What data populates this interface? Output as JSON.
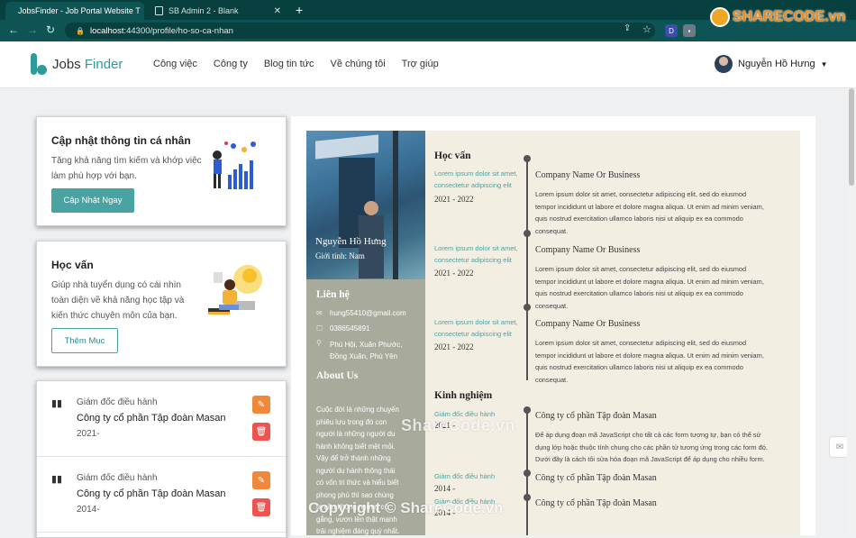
{
  "browser": {
    "tabs": [
      {
        "title": "JobsFinder - Job Portal Website T",
        "close": "✕"
      },
      {
        "title": "SB Admin 2 - Blank",
        "close": "✕"
      }
    ],
    "new_tab": "+",
    "url_host": "localhost",
    "url_rest": ":44300/profile/ho-so-ca-nhan"
  },
  "watermark": {
    "logo_text": "SHARECODE.vn",
    "center": "ShareCode.vn",
    "bottom": "Copyright © ShareCode.vn"
  },
  "nav": {
    "logo_main": "Jobs ",
    "logo_accent": "Finder",
    "menu": [
      "Công việc",
      "Công ty",
      "Blog tin tức",
      "Về chúng tôi",
      "Trợ giúp"
    ],
    "user_name": "Nguyễn Hồ Hưng"
  },
  "cards": {
    "update": {
      "title": "Cập nhật thông tin cá nhân",
      "desc_line1": "Tăng khả năng tìm kiếm và khớp việc",
      "desc_line2": "làm phù hợp với bạn.",
      "button": "Cập Nhật Ngay"
    },
    "education": {
      "title": "Học vấn",
      "desc_line1": "Giúp nhà tuyển dụng có cái nhìn",
      "desc_line2": "toàn diện về khả năng học tập và",
      "desc_line3": "kiến thức chuyên môn của bạn.",
      "button": "Thêm Mục"
    },
    "experience": [
      {
        "position": "Giám đốc điều hành",
        "company": "Công ty cổ phần Tập đoàn Masan",
        "year": "2021-"
      },
      {
        "position": "Giám đốc điều hành",
        "company": "Công ty cổ phần Tập đoàn Masan",
        "year": "2014-"
      }
    ]
  },
  "cv": {
    "name": "Nguyễn Hồ Hưng",
    "gender": "Giới tính: Nam",
    "contact_title": "Liên hệ",
    "email": "hung55410@gmail.com",
    "phone": "0386545891",
    "address_line1": "Phú Hội, Xuân Phước,",
    "address_line2": "Đồng Xuân, Phú Yên",
    "about_title": "About Us",
    "about_lines": [
      "Cuộc đời là những chuyến",
      "phiêu lưu trong đó con",
      "người là những người du",
      "hành không biết mệt mỏi.",
      "Vậy để trở thành những",
      "người du hành thông thái",
      "có vốn tri thức và hiểu biết",
      "phong phú thì sao chúng",
      "ta cần không ngừng cố",
      "gắng, vươn lên thật mạnh",
      "trải nghiệm đáng quý nhất."
    ],
    "education_title": "Học vấn",
    "education": [
      {
        "school_line1": "Lorem ipsum dolor sit amet,",
        "school_line2": "consectetur adipiscing elit",
        "years": "2021 - 2022",
        "major": "Company Name Or Business",
        "desc": [
          "Lorem ipsum dolor sit amet, consectetur adipiscing elit, sed do eiusmod",
          "tempor incididunt ut labore et dolore magna aliqua. Ut enim ad minim veniam,",
          "quis nostrud exercitation ullamco laboris nisi ut aliquip ex ea commodo",
          "consequat."
        ]
      },
      {
        "school_line1": "Lorem ipsum dolor sit amet,",
        "school_line2": "consectetur adipiscing elit",
        "years": "2021 - 2022",
        "major": "Company Name Or Business",
        "desc": [
          "Lorem ipsum dolor sit amet, consectetur adipiscing elit, sed do eiusmod",
          "tempor incididunt ut labore et dolore magna aliqua. Ut enim ad minim veniam,",
          "quis nostrud exercitation ullamco laboris nisi ut aliquip ex ea commodo",
          "consequat."
        ]
      },
      {
        "school_line1": "Lorem ipsum dolor sit amet,",
        "school_line2": "consectetur adipiscing elit",
        "years": "2021 - 2022",
        "major": "Company Name Or Business",
        "desc": [
          "Lorem ipsum dolor sit amet, consectetur adipiscing elit, sed do eiusmod",
          "tempor incididunt ut labore et dolore magna aliqua. Ut enim ad minim veniam,",
          "quis nostrud exercitation ullamco laboris nisi ut aliquip ex ea commodo",
          "consequat."
        ]
      }
    ],
    "experience_title": "Kinh nghiệm",
    "experience": [
      {
        "position": "Giám đốc điều hành",
        "years": "2021 -",
        "company": "Công ty cổ phần Tập đoàn Masan",
        "desc": [
          "Để áp dụng đoạn mã JavaScript cho tất cả các form tương tự, bạn có thể sử",
          "dụng lớp hoặc thuộc tính chung cho các phần tử tương ứng trong các form đó.",
          "Dưới đây là cách tôi sửa hóa đoạn mã JavaScript để áp dụng cho nhiều form."
        ]
      },
      {
        "position": "Giám đốc điều hành",
        "years": "2014 -",
        "company": "Công ty cổ phần Tập đoàn Masan"
      },
      {
        "position": "Giám đốc điều hành",
        "years": "2014 -",
        "company": "Công ty cổ phần Tập đoàn Masan"
      }
    ]
  }
}
